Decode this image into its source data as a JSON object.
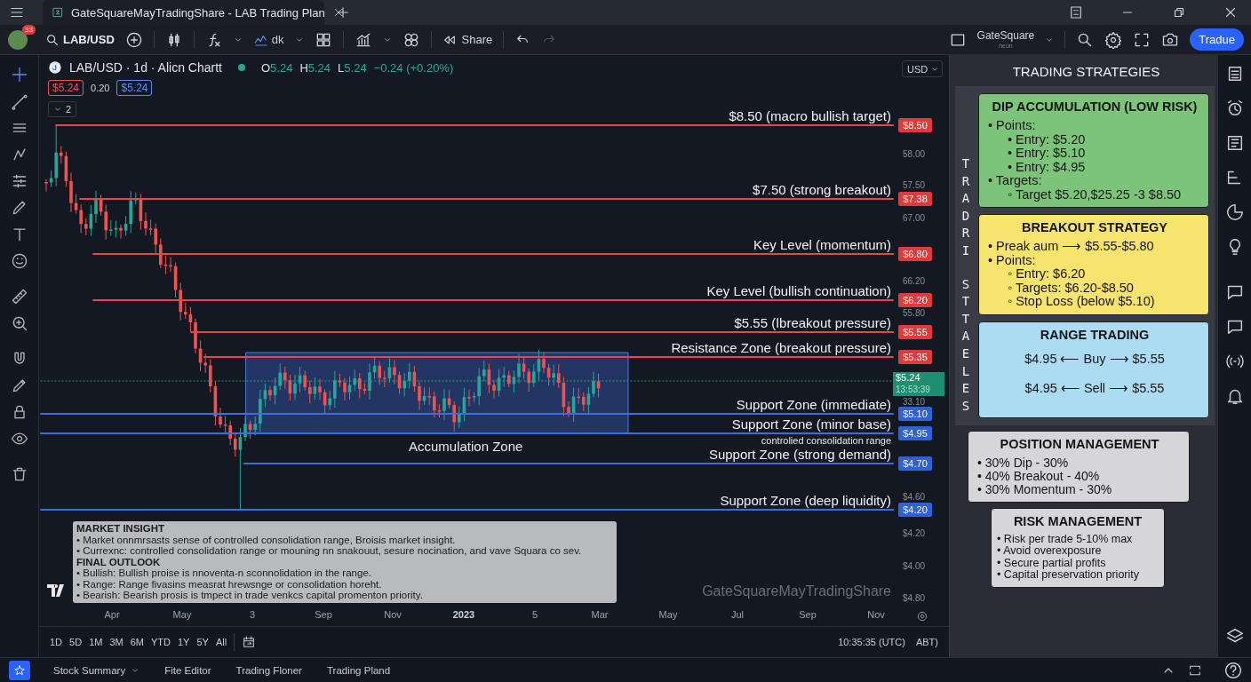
{
  "window": {
    "title": "GateSquareMayTradingShare - LAB Trading Plan"
  },
  "toolbar": {
    "badge": "33",
    "symbol": "LAB/USD",
    "indicator_label": "dk",
    "share": "Share",
    "broker": {
      "name": "GateSquare",
      "sub": "neon"
    },
    "trade_button": "Tradue"
  },
  "legend": {
    "title": "LAB/USD · 1d · Alicn Chartt",
    "ohlc": [
      {
        "key": "O",
        "value": "5.24"
      },
      {
        "key": "H",
        "value": "5.24"
      },
      {
        "key": "L",
        "value": "5.24"
      }
    ],
    "change": "−0.24 (+0.20%)",
    "bid": "$5.24",
    "spread": "0.20",
    "ask": "$5.24",
    "indicators_count": "2"
  },
  "chart": {
    "currency": "USD",
    "levels": [
      {
        "label": "$8.50 (macro bullish target)",
        "tag": "$8.50",
        "kind": "resistance"
      },
      {
        "label": "$7.50 (strong breakout)",
        "tag": "$7.38",
        "kind": "resistance"
      },
      {
        "label": "Key Level (momentum)",
        "tag": "$6.80",
        "kind": "resistance"
      },
      {
        "label": "Key Level (bullish continuation)",
        "tag": "$6.20",
        "kind": "resistance"
      },
      {
        "label": "$5.55 (ǀbreakout pressure)",
        "tag": "$5.55",
        "kind": "resistance"
      },
      {
        "label": "Resistance Zone (breakout pressure)",
        "tag": "$5.35",
        "kind": "resistance"
      },
      {
        "label": "Support Zone (immediate)",
        "tag": "$5.10",
        "kind": "support"
      },
      {
        "label": "Support Zone (minor base)",
        "tag": "$4.95",
        "kind": "support"
      },
      {
        "label": "Support Zone (strong demand)",
        "tag": "$4.70",
        "kind": "support"
      },
      {
        "label": "Support Zone (deep liquidity)",
        "tag": "$4.20",
        "kind": "support"
      }
    ],
    "axis_ticks": [
      "58.00",
      "57.50",
      "67.00",
      "66.20",
      "55.80",
      "33.10",
      "$4.60",
      "$4.20",
      "$4.00",
      "$4.80"
    ],
    "current_price": {
      "price": "$5.24",
      "countdown": "13:53:39"
    },
    "zone": {
      "label": "Accumulation Zone",
      "note": "controlied consolidation range"
    },
    "insight": [
      {
        "kind": "heading",
        "text": "MARKET INSIGHT"
      },
      {
        "kind": "bullet",
        "text": "• Market onnmrsasts sense of controlled consolidation range, Broisis market insight."
      },
      {
        "kind": "bullet",
        "text": "• Currexnc: controlled consolidation range or mouning nn snakouut, sesure nocination, and vave Squara co sev."
      },
      {
        "kind": "heading",
        "text": "FINAL OUTLOOK"
      },
      {
        "kind": "bullet",
        "text": "• Bullish: Bullish proise is nnoventa-n sconnolidation in the range."
      },
      {
        "kind": "bullet",
        "text": "• Range: Range fivasins measrat hrewsnge or consolidation horeht."
      },
      {
        "kind": "bullet",
        "text": "• Bearish: Bearish prosis is tmpect in trade venkcs capital promenton priority."
      }
    ],
    "watermark": "GateSquareMayTradingShare",
    "time_labels": [
      {
        "text": "Apr",
        "kind": "month"
      },
      {
        "text": "May",
        "kind": "month"
      },
      {
        "text": "3",
        "kind": "month"
      },
      {
        "text": "Sep",
        "kind": "month"
      },
      {
        "text": "Nov",
        "kind": "month"
      },
      {
        "text": "2023",
        "kind": "year"
      },
      {
        "text": "5",
        "kind": "month"
      },
      {
        "text": "Mar",
        "kind": "month"
      },
      {
        "text": "May",
        "kind": "month"
      },
      {
        "text": "Jul",
        "kind": "month"
      },
      {
        "text": "Sep",
        "kind": "month"
      },
      {
        "text": "Nov",
        "kind": "month"
      }
    ]
  },
  "range_bar": {
    "ranges": [
      "1D",
      "5D",
      "1M",
      "3M",
      "6M",
      "YTD",
      "1Y",
      "5Y",
      "All"
    ],
    "clock": "10:35:35 (UTC)",
    "extra": "ABT)"
  },
  "strategies": {
    "title": "TRADING STRATEGIES",
    "vertical_label": [
      "TRADRI",
      "STTAELES"
    ],
    "cards": [
      {
        "title": "DIP ACCUMULATION (LOW RISK)",
        "kind": "list",
        "color": "#7cc47a",
        "items": [
          {
            "text": "• Points:",
            "children": [
              {
                "text": "• Entry: $5.20"
              },
              {
                "text": "• Entry: $5.10"
              },
              {
                "text": "• Entry: $4.95"
              }
            ]
          },
          {
            "text": "• Targets:",
            "children": [
              {
                "text": "◦ Target $5.20,$25.25 -3 $8.50"
              }
            ]
          }
        ]
      },
      {
        "title": "BREAKOUT STRATEGY",
        "kind": "list",
        "color": "#f6e46e",
        "items": [
          {
            "text": "• Preak aum ⟶ $5.55-$5.80"
          },
          {
            "text": "• Points:",
            "children": [
              {
                "text": "◦ Entry: $6.20"
              },
              {
                "text": "◦ Targets: $6.20-$8.50"
              },
              {
                "text": "◦ Stop Loss (below $5.10)"
              }
            ]
          }
        ]
      },
      {
        "title": "RANGE TRADING",
        "kind": "range",
        "color": "#acdcf4",
        "items": [
          {
            "text": "$4.95 ⟵ Buy ⟶ $5.55"
          },
          {
            "text": "$4.95 ⟵ Sell ⟶ $5.55"
          }
        ]
      },
      {
        "title": "POSITION MANAGEMENT",
        "kind": "compact",
        "color": "#d6d6da",
        "items": [
          {
            "text": "• 30% Dip - 30%"
          },
          {
            "text": "• 40% Breakout - 40%"
          },
          {
            "text": "• 30% Momentum - 30%"
          }
        ]
      },
      {
        "title": "RISK MANAGEMENT",
        "kind": "small",
        "color": "#d6d6da",
        "items": [
          {
            "text": "• Risk per trade 5-10% max"
          },
          {
            "text": "• Avoid overexposure"
          },
          {
            "text": "• Secure partial profits"
          },
          {
            "text": "• Capital preservation priority"
          }
        ]
      }
    ]
  },
  "bottom_tabs": [
    "Stock Summary",
    "Fite Editor",
    "Trading Floner",
    "Trading Pland"
  ]
}
